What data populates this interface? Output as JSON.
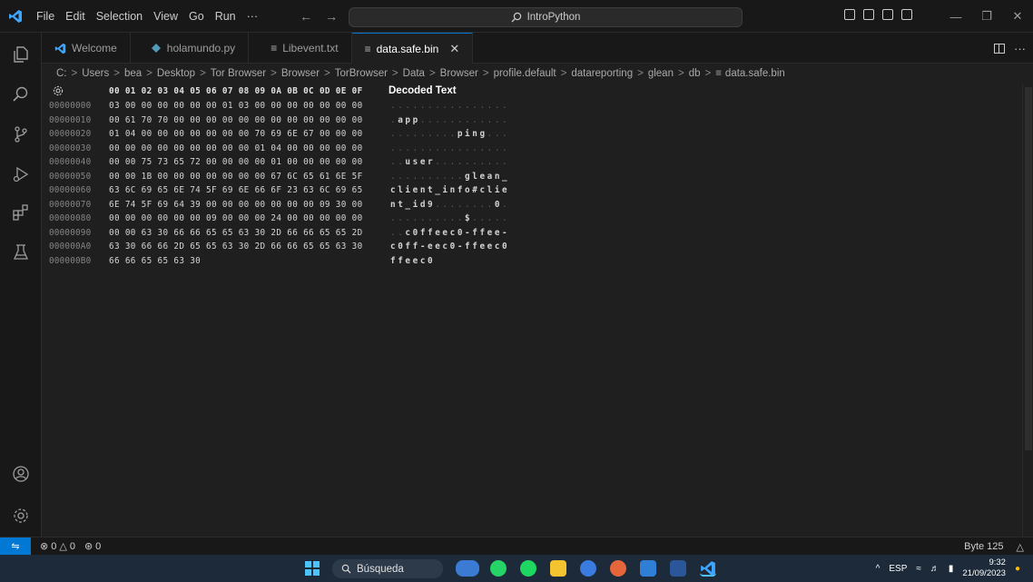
{
  "titlebar": {
    "menu": [
      "File",
      "Edit",
      "Selection",
      "View",
      "Go",
      "Run",
      "···"
    ],
    "search_text": "IntroPython"
  },
  "tabs": [
    {
      "label": "Welcome",
      "icon": "vscode-icon",
      "active": false
    },
    {
      "label": "holamundo.py",
      "icon": "python-icon",
      "active": false
    },
    {
      "label": "Libevent.txt",
      "icon": "text-file-icon",
      "active": false
    },
    {
      "label": "data.safe.bin",
      "icon": "text-file-icon",
      "active": true
    }
  ],
  "breadcrumb": [
    "C:",
    "Users",
    "bea",
    "Desktop",
    "Tor Browser",
    "Browser",
    "TorBrowser",
    "Data",
    "Browser",
    "profile.default",
    "datareporting",
    "glean",
    "db",
    "data.safe.bin"
  ],
  "hex": {
    "header_cols": "00 01 02 03 04 05 06 07 08 09 0A 0B 0C 0D 0E 0F",
    "decoded_title": "Decoded Text",
    "rows": [
      {
        "offset": "00000000",
        "bytes": "03 00 00 00 00 00 00 01 03 00 00 00 00 00 00 00",
        "decoded": "................"
      },
      {
        "offset": "00000010",
        "bytes": "00 61 70 70 00 00 00 00 00 00 00 00 00 00 00 00",
        "decoded": ".app............"
      },
      {
        "offset": "00000020",
        "bytes": "01 04 00 00 00 00 00 00 00 70 69 6E 67 00 00 00",
        "decoded": ".........ping..."
      },
      {
        "offset": "00000030",
        "bytes": "00 00 00 00 00 00 00 00 00 01 04 00 00 00 00 00",
        "decoded": "................"
      },
      {
        "offset": "00000040",
        "bytes": "00 00 75 73 65 72 00 00 00 00 01 00 00 00 00 00",
        "decoded": "..user.........."
      },
      {
        "offset": "00000050",
        "bytes": "00 00 1B 00 00 00 00 00 00 00 67 6C 65 61 6E 5F",
        "decoded": "..........glean_"
      },
      {
        "offset": "00000060",
        "bytes": "63 6C 69 65 6E 74 5F 69 6E 66 6F 23 63 6C 69 65",
        "decoded": "client_info#clie"
      },
      {
        "offset": "00000070",
        "bytes": "6E 74 5F 69 64 39 00 00 00 00 00 00 00 09 30 00",
        "decoded": "nt_id9........0."
      },
      {
        "offset": "00000080",
        "bytes": "00 00 00 00 00 00 09 00 00 00 24 00 00 00 00 00",
        "decoded": "..........$....."
      },
      {
        "offset": "00000090",
        "bytes": "00 00 63 30 66 66 65 65 63 30 2D 66 66 65 65 2D",
        "decoded": "..c0ffeec0-ffee-"
      },
      {
        "offset": "000000A0",
        "bytes": "63 30 66 66 2D 65 65 63 30 2D 66 66 65 65 63 30",
        "decoded": "c0ff-eec0-ffeec0"
      },
      {
        "offset": "000000B0",
        "bytes": "66 66 65 65 63 30",
        "decoded": "ffeec0"
      }
    ]
  },
  "statusbar": {
    "errors": "0",
    "warnings": "0",
    "ports": "0",
    "byte_label": "Byte 125"
  },
  "taskbar": {
    "search_label": "Búsqueda",
    "lang": "ESP",
    "time": "9:32",
    "date": "21/09/2023"
  },
  "colors": {
    "accent": "#0078d4",
    "editor_bg": "#1f1f1f",
    "chrome_bg": "#181818"
  }
}
